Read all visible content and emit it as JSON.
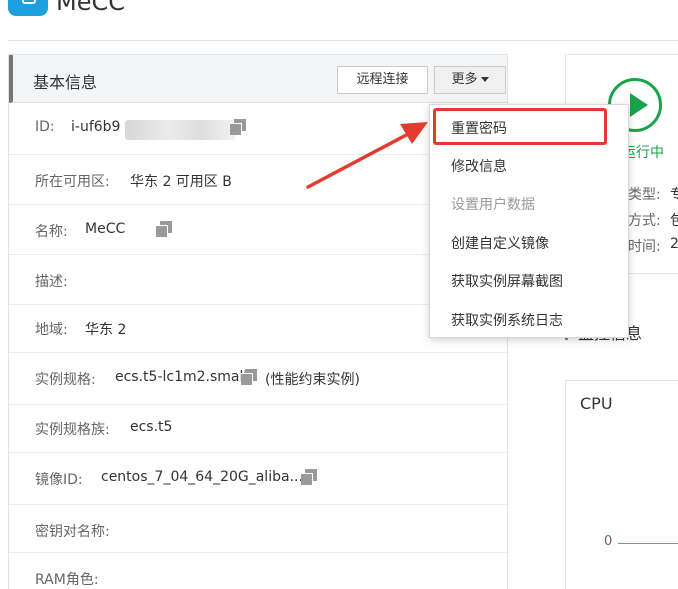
{
  "header": {
    "title": "MeCC"
  },
  "panel": {
    "title": "基本信息",
    "remote_button": "远程连接",
    "more_button": "更多"
  },
  "rows": [
    {
      "label": "ID:",
      "value": "i-uf6b9"
    },
    {
      "label": "所在可用区:",
      "value": "华东 2 可用区 B"
    },
    {
      "label": "名称:",
      "value": "MeCC"
    },
    {
      "label": "描述:",
      "value": ""
    },
    {
      "label": "地域:",
      "value": "华东 2"
    },
    {
      "label": "实例规格:",
      "value": "ecs.t5-lc1m2.small",
      "note": "(性能约束实例)"
    },
    {
      "label": "实例规格族:",
      "value": "ecs.t5"
    },
    {
      "label": "镜像ID:",
      "value": "centos_7_04_64_20G_aliba..."
    },
    {
      "label": "密钥对名称:",
      "value": ""
    },
    {
      "label": "RAM角色:",
      "value": ""
    }
  ],
  "dropdown": {
    "items": [
      {
        "label": "重置密码",
        "disabled": false
      },
      {
        "label": "修改信息",
        "disabled": false
      },
      {
        "label": "设置用户数据",
        "disabled": true
      },
      {
        "label": "创建自定义镜像",
        "disabled": false
      },
      {
        "label": "获取实例屏幕截图",
        "disabled": false
      },
      {
        "label": "获取实例系统日志",
        "disabled": false
      }
    ]
  },
  "status": {
    "running_text": "运行中",
    "lines": [
      {
        "label": "类型:",
        "value": "专"
      },
      {
        "label": "方式:",
        "value": "包"
      },
      {
        "label": "时间:",
        "value": "2"
      }
    ]
  },
  "monitor": {
    "title": "监控信息"
  },
  "cpu": {
    "title": "CPU",
    "axis_zero": "0"
  },
  "colors": {
    "highlight": "#e53a2e",
    "running": "#1aa34a",
    "accent": "#4a90e2"
  }
}
